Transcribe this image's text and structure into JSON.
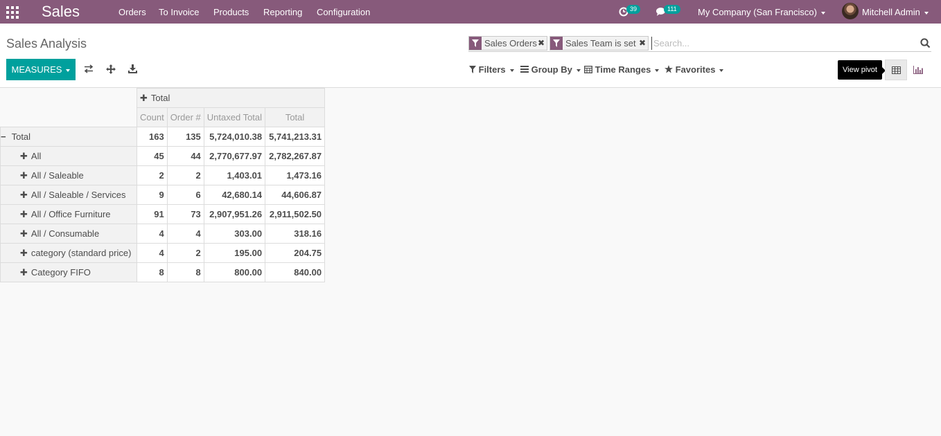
{
  "navbar": {
    "brand": "Sales",
    "menu": [
      "Orders",
      "To Invoice",
      "Products",
      "Reporting",
      "Configuration"
    ],
    "activity_count": "39",
    "message_count": "111",
    "company": "My Company (San Francisco)",
    "user": "Mitchell Admin"
  },
  "control_panel": {
    "title": "Sales Analysis",
    "facets": [
      "Sales Orders",
      "Sales Team is set"
    ],
    "search_placeholder": "Search...",
    "measures_label": "MEASURES",
    "filters_label": "Filters",
    "groupby_label": "Group By",
    "timeranges_label": "Time Ranges",
    "favorites_label": "Favorites",
    "tooltip": "View pivot"
  },
  "pivot": {
    "col_header": "Total",
    "measures": [
      "Count",
      "Order #",
      "Untaxed Total",
      "Total"
    ],
    "rows": [
      {
        "label": "Total",
        "values": [
          "163",
          "135",
          "5,724,010.38",
          "5,741,213.31"
        ]
      },
      {
        "label": "All",
        "values": [
          "45",
          "44",
          "2,770,677.97",
          "2,782,267.87"
        ]
      },
      {
        "label": "All / Saleable",
        "values": [
          "2",
          "2",
          "1,403.01",
          "1,473.16"
        ]
      },
      {
        "label": "All / Saleable / Services",
        "values": [
          "9",
          "6",
          "42,680.14",
          "44,606.87"
        ]
      },
      {
        "label": "All / Office Furniture",
        "values": [
          "91",
          "73",
          "2,907,951.26",
          "2,911,502.50"
        ]
      },
      {
        "label": "All / Consumable",
        "values": [
          "4",
          "4",
          "303.00",
          "318.16"
        ]
      },
      {
        "label": "category (standard price)",
        "values": [
          "4",
          "2",
          "195.00",
          "204.75"
        ]
      },
      {
        "label": "Category FIFO",
        "values": [
          "8",
          "8",
          "800.00",
          "840.00"
        ]
      }
    ]
  },
  "colors": {
    "brand": "#875a7b",
    "accent": "#00a09d"
  }
}
